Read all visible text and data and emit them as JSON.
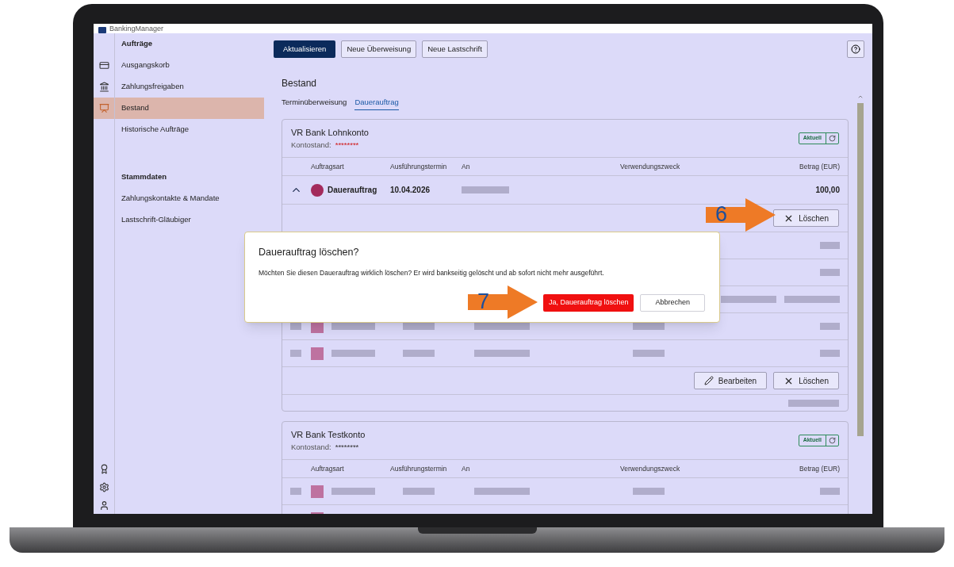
{
  "app": {
    "title": "BankingManager"
  },
  "sidebar": {
    "sections": [
      {
        "heading": "Aufträge",
        "items": [
          {
            "label": "Ausgangskorb",
            "selected": false
          },
          {
            "label": "Zahlungsfreigaben",
            "selected": false
          },
          {
            "label": "Bestand",
            "selected": true
          },
          {
            "label": "Historische Aufträge",
            "selected": false
          }
        ]
      },
      {
        "heading": "Stammdaten",
        "items": [
          {
            "label": "Zahlungskontakte & Mandate",
            "selected": false
          },
          {
            "label": "Lastschrift-Gläubiger",
            "selected": false
          }
        ]
      }
    ]
  },
  "toolbar": {
    "buttons": [
      {
        "label": "Aktualisieren",
        "kind": "primary"
      },
      {
        "label": "Neue Überweisung",
        "kind": "secondary"
      },
      {
        "label": "Neue Lastschrift",
        "kind": "secondary"
      }
    ]
  },
  "heading": "Bestand",
  "tabs": [
    {
      "label": "Terminüberweisung",
      "selected": false
    },
    {
      "label": "Dauerauftrag",
      "selected": true
    }
  ],
  "accounts": [
    {
      "name": "VR Bank Lohnkonto",
      "balance_label": "Kontostand:",
      "balance": "********",
      "balance_alert": true,
      "status": "Aktuell",
      "columns": [
        "Auftragsart",
        "Ausführungstermin",
        "An",
        "Verwendungszweck",
        "Betrag (EUR)"
      ],
      "rows": [
        {
          "kind": "order",
          "expanded": true,
          "type": "Dauerauftrag",
          "date": "10.04.2026",
          "amount": "100,00"
        },
        {
          "kind": "actions",
          "buttons": [
            {
              "label": "Löschen",
              "kind": "delete"
            }
          ]
        },
        {
          "kind": "blurred"
        },
        {
          "kind": "blurred"
        },
        {
          "kind": "blurred-actions"
        },
        {
          "kind": "blurred"
        },
        {
          "kind": "blurred"
        },
        {
          "kind": "actions",
          "buttons": [
            {
              "label": "Bearbeiten",
              "kind": "edit"
            },
            {
              "label": "Löschen",
              "kind": "delete"
            }
          ]
        },
        {
          "kind": "blurred-footer"
        }
      ]
    },
    {
      "name": "VR Bank Testkonto",
      "balance_label": "Kontostand:",
      "balance": "********",
      "balance_alert": false,
      "status": "Aktuell",
      "columns": [
        "Auftragsart",
        "Ausführungstermin",
        "An",
        "Verwendungszweck",
        "Betrag (EUR)"
      ],
      "rows": [
        {
          "kind": "blurred"
        },
        {
          "kind": "blurred"
        }
      ]
    }
  ],
  "dialog": {
    "title": "Dauerauftrag löschen?",
    "message": "Möchten Sie diesen Dauerauftrag wirklich löschen? Er wird bankseitig gelöscht und ab sofort nicht mehr ausgeführt.",
    "confirm": "Ja, Dauerauftrag löschen",
    "cancel": "Abbrechen"
  },
  "annotations": [
    {
      "label": "6"
    },
    {
      "label": "7"
    }
  ]
}
